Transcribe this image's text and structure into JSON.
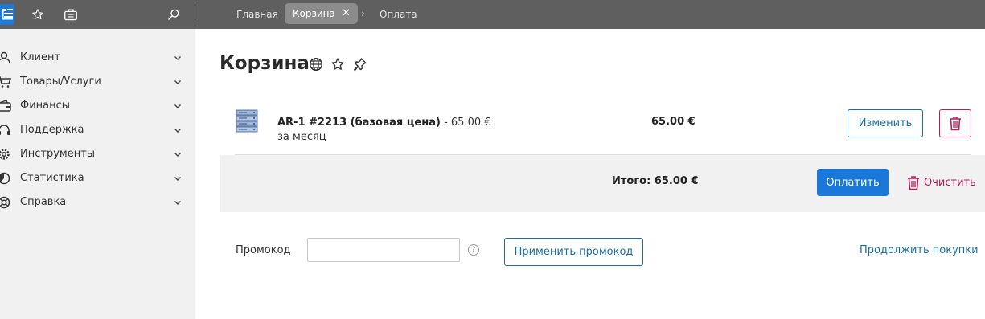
{
  "topbar": {
    "breadcrumbs": [
      {
        "label": "Главная"
      },
      {
        "label": "Корзина",
        "active": true
      },
      {
        "label": "Оплата"
      }
    ],
    "close_glyph": "✕",
    "separator_glyph": "›",
    "icons": [
      "logo-icon",
      "star-icon",
      "briefcase-icon",
      "search-icon"
    ]
  },
  "sidebar": {
    "items": [
      {
        "label": "Клиент",
        "icon": "user-icon"
      },
      {
        "label": "Товары/Услуги",
        "icon": "cart-icon"
      },
      {
        "label": "Финансы",
        "icon": "wallet-icon"
      },
      {
        "label": "Поддержка",
        "icon": "headset-icon"
      },
      {
        "label": "Инструменты",
        "icon": "gear-icon"
      },
      {
        "label": "Статистика",
        "icon": "pie-chart-icon"
      },
      {
        "label": "Справка",
        "icon": "lifebuoy-icon"
      }
    ]
  },
  "main": {
    "title": "Корзина",
    "cart": {
      "item": {
        "name": "AR-1 #2213 (базовая цена)",
        "detail": " - 65.00 € за месяц",
        "price": "65.00 €",
        "edit_label": "Изменить"
      },
      "total": "Итого: 65.00 €",
      "pay_label": "Оплатить",
      "clear_label": "Очистить"
    },
    "promo": {
      "label": "Промокод",
      "value": "",
      "help": "?",
      "apply_label": "Применить промокод"
    },
    "continue_label": "Продолжить покупки"
  },
  "colors": {
    "topbar_bg": "#5f5f5f",
    "sidebar_bg": "#f1f1f1",
    "accent": "#1c78d8",
    "link": "#1a6fa8",
    "danger": "#b11e5a"
  }
}
